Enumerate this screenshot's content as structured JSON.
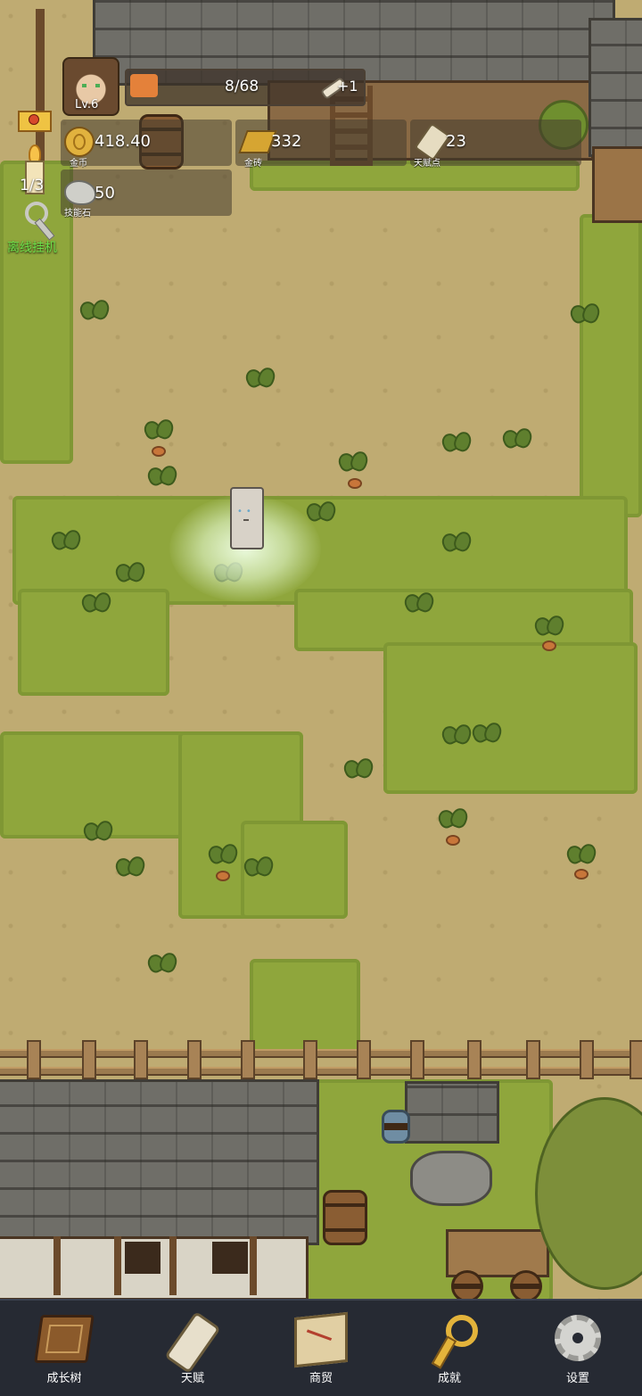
{
  "hud": {
    "level": "Lv.6",
    "xp_text": "8/68",
    "xp_progress": 0.12,
    "bonus_text": "+1",
    "resources": [
      {
        "value": "418.40",
        "label": "金币",
        "icon": "gold-coin-icon"
      },
      {
        "value": "332",
        "label": "金砖",
        "icon": "gold-bar-icon"
      },
      {
        "value": "23",
        "label": "天赋点",
        "icon": "talent-scroll-icon"
      },
      {
        "value": "50",
        "label": "技能石",
        "icon": "skill-stone-icon"
      }
    ]
  },
  "side": {
    "candle_count": "1/3",
    "idle_label": "离线挂机",
    "idle_label_color": "#6ee04a"
  },
  "nav": {
    "items": [
      {
        "label": "成长树",
        "icon": "growth-book-icon"
      },
      {
        "label": "天赋",
        "icon": "talent-scroll-icon"
      },
      {
        "label": "商贸",
        "icon": "trade-map-icon"
      },
      {
        "label": "成就",
        "icon": "achievement-key-icon"
      },
      {
        "label": "设置",
        "icon": "settings-gear-icon"
      }
    ]
  },
  "colors": {
    "ground": "#bfab72",
    "grass": "#8fa63c",
    "nav_bg": "#262a33",
    "xp_fill": "#e4813a"
  }
}
